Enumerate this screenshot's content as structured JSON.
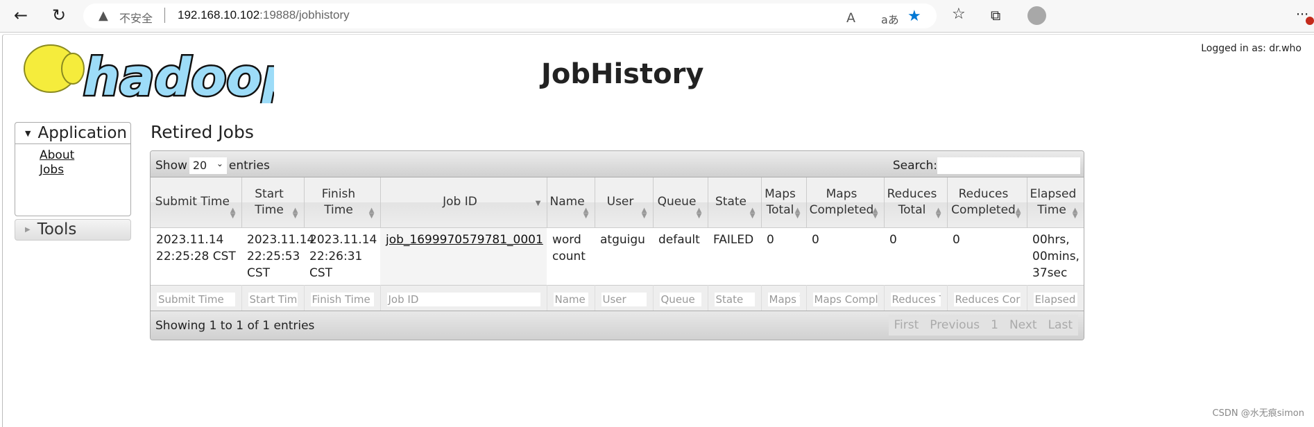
{
  "browser": {
    "security": "不安全",
    "url_host": "192.168.10.102",
    "url_rest": ":19888/jobhistory",
    "icons": [
      "back-icon",
      "reload-icon",
      "warning-icon",
      "read-aloud-icon",
      "translate-icon",
      "favorite-star-icon",
      "favorites-icon",
      "collections-icon",
      "profile-avatar",
      "more-icon"
    ],
    "accent": "#0078d4"
  },
  "header": {
    "logo_text": "hadoop",
    "logged_in": "Logged in as: dr.who",
    "title": "JobHistory"
  },
  "sidebar": {
    "application": "Application",
    "links": [
      "About",
      "Jobs"
    ],
    "tools": "Tools"
  },
  "main": {
    "heading": "Retired Jobs",
    "show_label": "Show",
    "entries_value": "20",
    "entries_label": "entries",
    "search_label": "Search:",
    "columns": [
      "Submit Time",
      "Start Time",
      "Finish Time",
      "Job ID",
      "Name",
      "User",
      "Queue",
      "State",
      "Maps Total",
      "Maps Completed",
      "Reduces Total",
      "Reduces Completed",
      "Elapsed Time"
    ],
    "rows": [
      [
        "2023.11.14 22:25:28 CST",
        "2023.11.14 22:25:53 CST",
        "2023.11.14 22:26:31 CST",
        "job_1699970579781_0001",
        "word count",
        "atguigu",
        "default",
        "FAILED",
        "0",
        "0",
        "0",
        "0",
        "00hrs, 00mins, 37sec"
      ]
    ],
    "filters": [
      "Submit Time",
      "Start Time",
      "Finish Time",
      "Job ID",
      "Name",
      "User",
      "Queue",
      "State",
      "Maps T",
      "Maps Compl",
      "Reduces T",
      "Reduces Cor",
      "Elapsed T"
    ],
    "info": "Showing 1 to 1 of 1 entries",
    "pager": [
      "First",
      "Previous",
      "1",
      "Next",
      "Last"
    ]
  },
  "watermark": "CSDN @水无痕simon"
}
